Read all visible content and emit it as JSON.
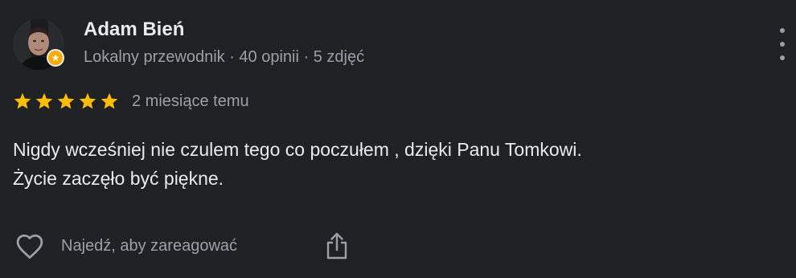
{
  "review": {
    "author": {
      "name": "Adam Bień",
      "meta": "Lokalny przewodnik · 40 opinii · 5 zdjęć",
      "avatar_icon": "user-avatar-photo",
      "badge_icon": "local-guide-star-icon",
      "badge_color": "#f9ab00"
    },
    "rating": {
      "stars": 5,
      "max_stars": 5,
      "star_color": "#fbbc04"
    },
    "date": "2 miesiące temu",
    "text_lines": [
      "Nigdy wcześniej nie czulem tego co poczułem , dzięki Panu Tomkowi.",
      "Życie zaczęło być piękne."
    ],
    "actions": {
      "react_label": "Najedź, aby zareagować",
      "react_icon": "heart-icon",
      "share_icon": "share-icon",
      "more_icon": "more-vert-icon"
    }
  },
  "colors": {
    "background": "#202124",
    "primary_text": "#e8eaed",
    "secondary_text": "#9aa0a6"
  }
}
